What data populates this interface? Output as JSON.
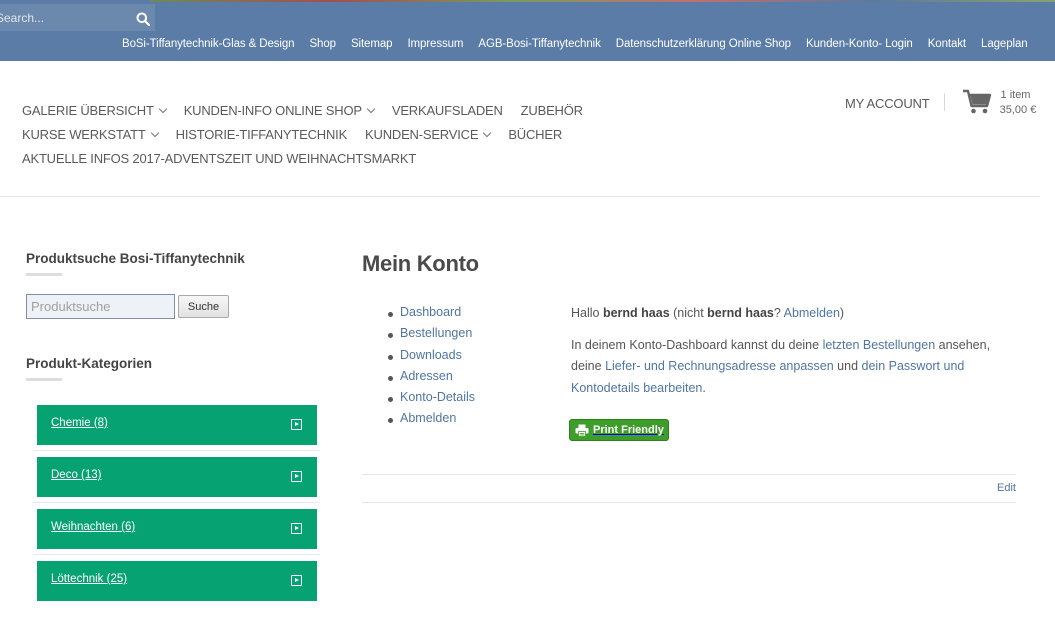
{
  "topbar": {
    "search_placeholder": "Search...",
    "links": [
      "BoSi-Tiffanytechnik-Glas & Design",
      "Shop",
      "Sitemap",
      "Impressum",
      "AGB-Bosi-Tiffanytechnik",
      "Datenschutzerklärung Online Shop",
      "Kunden-Konto- Login",
      "Kontakt",
      "Lageplan"
    ]
  },
  "mainnav": {
    "row1": [
      {
        "label": "GALERIE ÜBERSICHT",
        "dropdown": true
      },
      {
        "label": "KUNDEN-INFO ONLINE SHOP",
        "dropdown": true
      },
      {
        "label": "VERKAUFSLADEN",
        "dropdown": false
      },
      {
        "label": "ZUBEHÖR",
        "dropdown": false
      }
    ],
    "row2": [
      {
        "label": "KURSE WERKSTATT",
        "dropdown": true
      },
      {
        "label": "HISTORIE-TIFFANYTECHNIK",
        "dropdown": false
      },
      {
        "label": "KUNDEN-SERVICE",
        "dropdown": true
      },
      {
        "label": "BÜCHER",
        "dropdown": false
      }
    ],
    "row3": [
      {
        "label": "AKTUELLE INFOS 2017-ADVENTSZEIT UND WEIHNACHTSMARKT",
        "dropdown": false
      }
    ]
  },
  "header": {
    "my_account": "MY ACCOUNT",
    "cart_count": "1 item",
    "cart_total": "35,00 €",
    "cart_icon": "shopping-cart-icon"
  },
  "sidebar": {
    "search_title": "Produktsuche Bosi-Tiffanytechnik",
    "search_placeholder": "Produktsuche",
    "search_button": "Suche",
    "categories_title": "Produkt-Kategorien",
    "categories": [
      {
        "label": "Chemie (8)"
      },
      {
        "label": "Deco (13)"
      },
      {
        "label": "Weihnachten (6)"
      },
      {
        "label": "Löttechnik (25)"
      }
    ],
    "category_color": "#06a272"
  },
  "content": {
    "title": "Mein Konto",
    "account_nav": [
      "Dashboard",
      "Bestellungen",
      "Downloads",
      "Adressen",
      "Konto-Details",
      "Abmelden"
    ],
    "greeting_prefix": "Hallo ",
    "user_name": "bernd haas",
    "greeting_middle": " (nicht ",
    "greeting_user2": "bernd haas",
    "greeting_q": "? ",
    "logout_link": "Abmelden",
    "greeting_suffix": ")",
    "desc_part1": "In deinem Konto-Dashboard kannst du deine ",
    "desc_link1": "letzten Bestellungen",
    "desc_part2": " ansehen, deine ",
    "desc_link2": "Liefer- und Rechnungsadresse anpassen",
    "desc_part3": " und ",
    "desc_link3": "dein Passwort und Kontodetails bearbeiten",
    "desc_part4": ".",
    "print_button": "Print Friendly",
    "edit_link": "Edit"
  },
  "colors": {
    "topbar": "#5a7ca6",
    "link": "#4f76a3",
    "print_button": "#3f9d2c"
  }
}
